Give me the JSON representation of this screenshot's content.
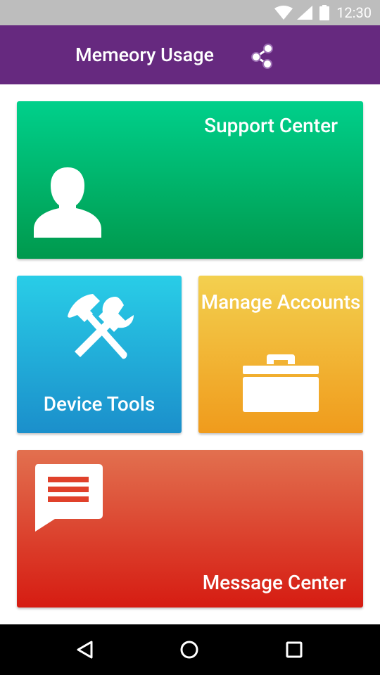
{
  "status_bar": {
    "time": "12:30",
    "icons": [
      "wifi-icon",
      "cell-signal-icon",
      "battery-icon"
    ]
  },
  "app_bar": {
    "title": "Memeory Usage",
    "action_icon": "share-icon",
    "background": "#66297f"
  },
  "tiles": {
    "support": {
      "label": "Support Center",
      "icon": "person-icon",
      "color_top": "#00d08b",
      "color_bottom": "#00994d"
    },
    "devices": {
      "label": "Device Tools",
      "icon": "hammer-wrench-icon",
      "color_top": "#29cde7",
      "color_bottom": "#1b8fcb"
    },
    "accounts": {
      "label": "Manage Accounts",
      "icon": "briefcase-icon",
      "color_top": "#f3d04f",
      "color_bottom": "#f09b1c"
    },
    "messages": {
      "label": "Message Center",
      "icon": "chat-message-icon",
      "color_top": "#e2704f",
      "color_bottom": "#d61c12"
    }
  },
  "nav_bar": {
    "buttons": [
      "back-icon",
      "home-icon",
      "recents-icon"
    ]
  }
}
